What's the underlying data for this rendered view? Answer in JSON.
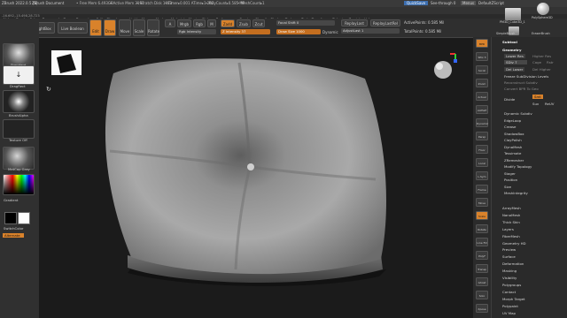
{
  "titlebar": {
    "app": "ZBrush 2022.0.5 [S]",
    "doc": "ZBrush Document",
    "free_mem": "• Free Mem 6.493GB",
    "active_mem": "• Active Mem 3197",
    "scratch": "• Scratch Disk 1083",
    "timer": "• Timer▸0.001 ATime▸1.202",
    "polycount": "• PolyCount▸0.585 MP",
    "meshcount": "• MeshCount▸1",
    "quicksave": "QuickSave",
    "seethrough": "See-through 0",
    "menus_label": "Menus",
    "defaultscript": "DefaultZScript"
  },
  "menubar": [
    "Alpha",
    "Brush",
    "Color",
    "Document",
    "Draw",
    "Dynamics",
    "Edit",
    "File",
    "Layer",
    "Light",
    "Macro",
    "Marker",
    "Material",
    "Movie",
    "Picker",
    "Preferences",
    "Render",
    "Stencil",
    "Stroke",
    "Texture",
    "Tool",
    "Transform",
    "Zplugin",
    "Zscript",
    "Help"
  ],
  "coords": "-16.692,-15.498,28.723",
  "toolbar": {
    "home": "Home Page",
    "lightbox": "LightBox",
    "liveboolean": "Live Boolean",
    "edit": "Edit",
    "draw": "Draw",
    "move": "Move",
    "scale": "Scale",
    "rotate": "Rotate",
    "a": "A",
    "mrgb": "Mrgb",
    "rgb": "Rgb",
    "m": "M",
    "zadd": "Zadd",
    "zsub": "Zsub",
    "zcut": "Zcut",
    "rgb_intensity": "Rgb Intensity",
    "z_intensity": "Z Intensity 37",
    "focal_shift": "Focal Shift 0",
    "draw_size": "Draw Size 1000",
    "dynamic": "Dynamic",
    "replay_last": "ReplayLast",
    "replay_last_rel": "ReplayLastRel",
    "adjust_last": "AdjustLast 1",
    "active_points": "ActivePoints: 0.585 Mil",
    "total_points": "TotalPoints: 0.585 Mil"
  },
  "leftshelf": {
    "standard": "Standard",
    "dragrect": "DragRect",
    "brushalpha": "BrushAlpha",
    "texture_off": "Texture Off",
    "matcap": "MatCap Gray",
    "gradient": "Gradient",
    "switchcolor": "SwitchColor",
    "alternate": "Alternate"
  },
  "rtools": [
    "BPR",
    "SPix 3",
    "Scroll",
    "Zoom",
    "Actual",
    "AAHalf",
    "Dynamic",
    "Persp",
    "Floor",
    "Local",
    "L.Sym",
    "Frame",
    "Move",
    "Scale",
    "Rotate",
    "Line Fill",
    "PolyF",
    "Transp",
    "Ghost",
    "Solo",
    "Xpose"
  ],
  "tray": {
    "topright_thumb1": "PM3D_Cube3D_1",
    "topright_thumb2": "PolySphere3D",
    "simple": "SimpleBrush",
    "eraser": "EraserBrush",
    "subtool": "Subtool",
    "geometry": "Geometry",
    "lower_res": "Lower Res",
    "higher_res": "Higher Res",
    "sdiv": "SDiv 7",
    "cage": "Cage",
    "rstr": "Rstr",
    "del_lower": "Del Lower",
    "del_higher": "Del Higher",
    "freeze": "Freeze SubDivision Levels",
    "reconstruct": "Reconstruct Subdiv",
    "convert": "Convert BPR To Geo",
    "divide": "Divide",
    "smt": "Smt",
    "suv": "Suv",
    "reuv": "ReUV",
    "sections": [
      "Dynamic Subdiv",
      "EdgeLoop",
      "Crease",
      "ShadowBox",
      "ClayPolish",
      "DynaMesh",
      "Tessimate",
      "ZRemesher",
      "Modify Topology",
      "Stager",
      "Position",
      "Size",
      "MeshIntegrity"
    ],
    "subpalettes": [
      "ArrayMesh",
      "NanoMesh",
      "Thick Skin",
      "Layers",
      "FiberMesh",
      "Geometry HD",
      "Preview",
      "Surface",
      "Deformation",
      "Masking",
      "Visibility",
      "Polygroups",
      "Contact",
      "Morph Target",
      "Polypaint",
      "UV Map"
    ]
  },
  "colors": {
    "accent": "#d9822b",
    "panel": "#2a2a2a",
    "viewport": "#1b1b1b"
  }
}
